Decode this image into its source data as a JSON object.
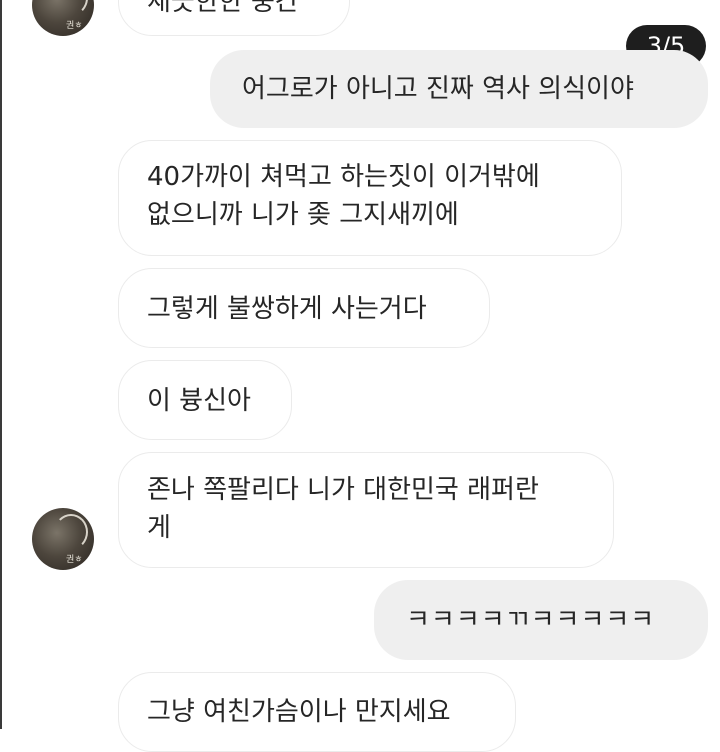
{
  "image_counter": "3/5",
  "avatar_tag": "권ㅎ",
  "messages": [
    {
      "side": "received",
      "text": "새끗한한 중간"
    },
    {
      "side": "sent",
      "text": "어그로가 아니고 진짜 역사 의식이야"
    },
    {
      "side": "received",
      "lines": [
        "40가까이 쳐먹고 하는짓이 이거밖에",
        "없으니까 니가 좆 그지새끼에"
      ]
    },
    {
      "side": "received",
      "text": "그렇게 불쌍하게 사는거다"
    },
    {
      "side": "received",
      "text": "이 븅신아"
    },
    {
      "side": "received",
      "lines": [
        "존나 쪽팔리다 니가 대한민국 래퍼란",
        "게"
      ]
    },
    {
      "side": "sent",
      "text": "ㅋㅋㅋㅋㄲㅋㅋㅋㅋㅋ"
    },
    {
      "side": "received",
      "text": "그냥 여친가슴이나 만지세요"
    }
  ]
}
